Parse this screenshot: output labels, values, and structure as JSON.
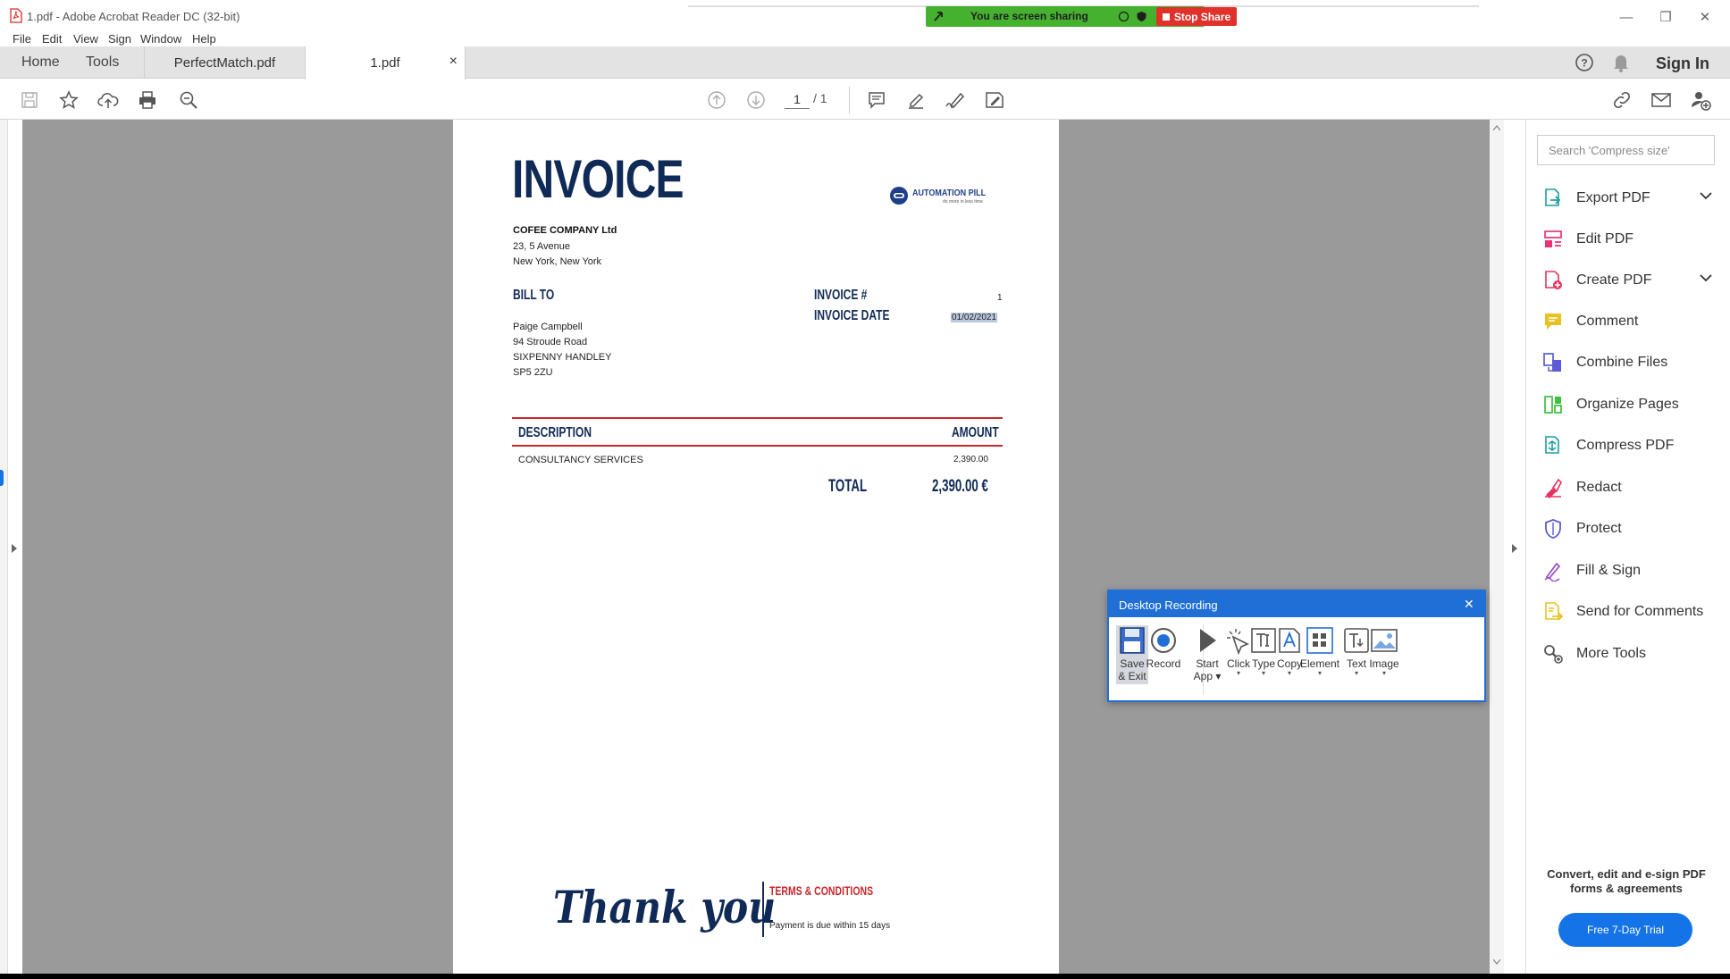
{
  "window": {
    "title": "1.pdf - Adobe Acrobat Reader DC (32-bit)",
    "minimize": "—",
    "maximize": "❐",
    "close": "✕"
  },
  "screen_share": {
    "status": "You are screen sharing",
    "stop_label": "Stop Share"
  },
  "menu": [
    "File",
    "Edit",
    "View",
    "Sign",
    "Window",
    "Help"
  ],
  "nav_tabs": {
    "home": "Home",
    "tools": "Tools"
  },
  "file_tabs": [
    {
      "label": "PerfectMatch.pdf",
      "active": false
    },
    {
      "label": "1.pdf",
      "active": true,
      "close": "×"
    }
  ],
  "header": {
    "sign_in": "Sign In"
  },
  "toolbar": {
    "page_current": "1",
    "page_total": "/ 1"
  },
  "invoice": {
    "title": "INVOICE",
    "logo_text": "AUTOMATION PILL",
    "logo_tagline": "do more in less time",
    "company_name": "COFEE COMPANY Ltd",
    "company_address": [
      "23, 5 Avenue",
      "New York, New York"
    ],
    "bill_to_label": "BILL TO",
    "bill_to": [
      "Paige Campbell",
      "94 Stroude Road",
      "SIXPENNY HANDLEY",
      "SP5 2ZU"
    ],
    "invoice_no_label": "INVOICE #",
    "invoice_no": "1",
    "invoice_date_label": "INVOICE DATE",
    "invoice_date": "01/02/2021",
    "col_description": "DESCRIPTION",
    "col_amount": "AMOUNT",
    "line_description": "CONSULTANCY SERVICES",
    "line_amount": "2,390.00",
    "total_label": "TOTAL",
    "total_value": "2,390.00 €",
    "thank_you": "Thank you",
    "terms_label": "TERMS & CONDITIONS",
    "terms_text": "Payment is due within 15 days"
  },
  "right_panel": {
    "search_placeholder": "Search 'Compress size'",
    "tools": [
      {
        "label": "Export PDF",
        "color": "#1a9fa0",
        "expand": true
      },
      {
        "label": "Edit PDF",
        "color": "#e8337a",
        "expand": false
      },
      {
        "label": "Create PDF",
        "color": "#e8335e",
        "expand": true
      },
      {
        "label": "Comment",
        "color": "#e7c220",
        "expand": false
      },
      {
        "label": "Combine Files",
        "color": "#5b5bd6",
        "expand": false
      },
      {
        "label": "Organize Pages",
        "color": "#3ebf3e",
        "expand": false
      },
      {
        "label": "Compress PDF",
        "color": "#1a9fa0",
        "expand": false
      },
      {
        "label": "Redact",
        "color": "#e8335e",
        "expand": false
      },
      {
        "label": "Protect",
        "color": "#5b5bd6",
        "expand": false
      },
      {
        "label": "Fill & Sign",
        "color": "#9a49c9",
        "expand": false
      },
      {
        "label": "Send for Comments",
        "color": "#e7c220",
        "expand": false
      },
      {
        "label": "More Tools",
        "color": "#555555",
        "expand": false
      }
    ],
    "promo": "Convert, edit and e-sign PDF forms & agreements",
    "trial_button": "Free 7-Day Trial"
  },
  "recording": {
    "title": "Desktop Recording",
    "close": "✕",
    "buttons": [
      {
        "label": "Save\n& Exit",
        "caret": false
      },
      {
        "label": "Record",
        "caret": false
      },
      {
        "label": "Start\nApp ▾",
        "caret": false
      },
      {
        "label": "Click",
        "caret": true
      },
      {
        "label": "Type",
        "caret": true
      },
      {
        "label": "Copy",
        "caret": true
      },
      {
        "label": "Element",
        "caret": true
      },
      {
        "label": "Text",
        "caret": true
      },
      {
        "label": "Image",
        "caret": true
      }
    ]
  }
}
